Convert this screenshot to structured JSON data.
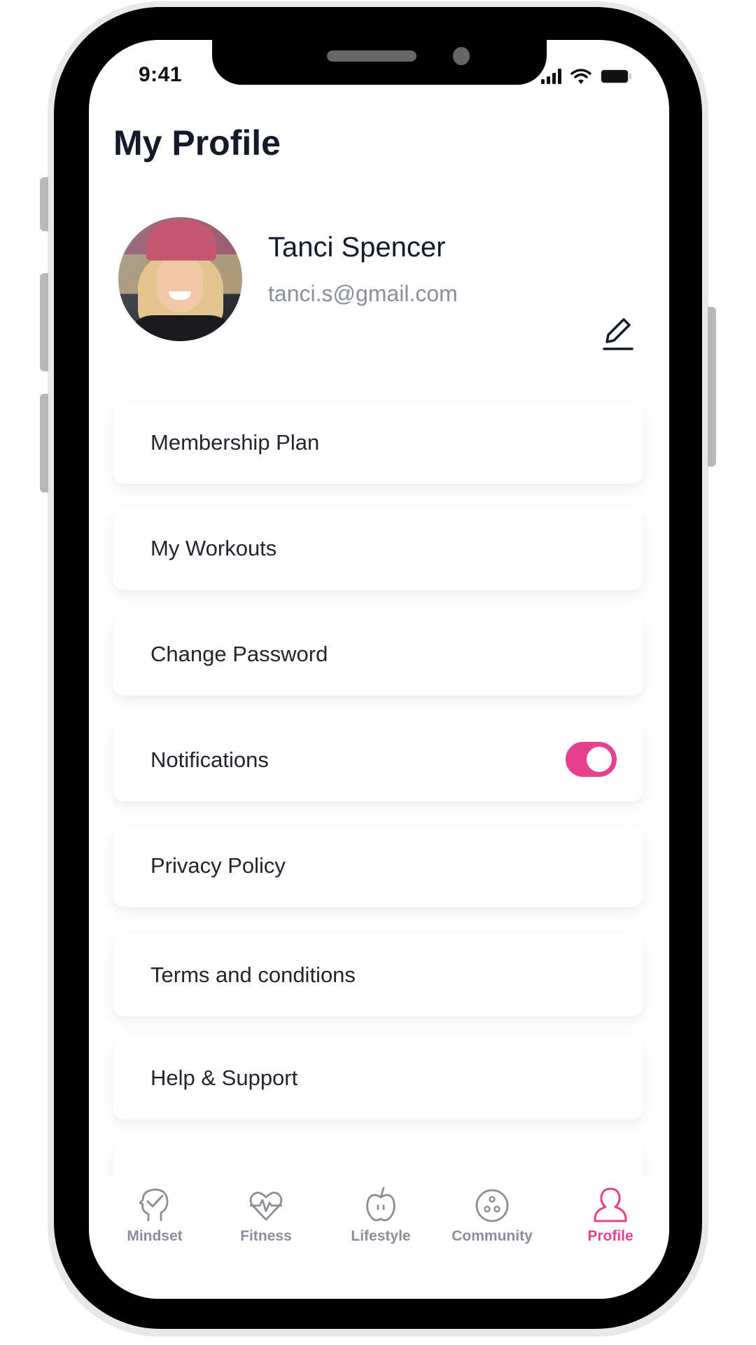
{
  "status_bar": {
    "time": "9:41"
  },
  "header": {
    "title": "My Profile"
  },
  "profile": {
    "name": "Tanci Spencer",
    "email": "tanci.s@gmail.com",
    "avatar_icon": "user-photo",
    "edit_icon": "pencil-icon"
  },
  "menu": [
    {
      "label": "Membership Plan"
    },
    {
      "label": "My Workouts"
    },
    {
      "label": "Change Password"
    },
    {
      "label": "Notifications",
      "toggle": true,
      "toggle_on": true
    },
    {
      "label": "Privacy Policy"
    },
    {
      "label": "Terms and conditions"
    },
    {
      "label": "Help & Support"
    },
    {
      "label": ""
    }
  ],
  "bottom_nav": [
    {
      "label": "Mindset",
      "icon": "head-check-icon",
      "active": false
    },
    {
      "label": "Fitness",
      "icon": "heart-pulse-icon",
      "active": false
    },
    {
      "label": "Lifestyle",
      "icon": "apple-icon",
      "active": false
    },
    {
      "label": "Community",
      "icon": "community-circle-icon",
      "active": false
    },
    {
      "label": "Profile",
      "icon": "user-icon",
      "active": true
    }
  ],
  "colors": {
    "accent": "#e8408e",
    "text": "#141a2a",
    "muted": "#8b8e99"
  }
}
